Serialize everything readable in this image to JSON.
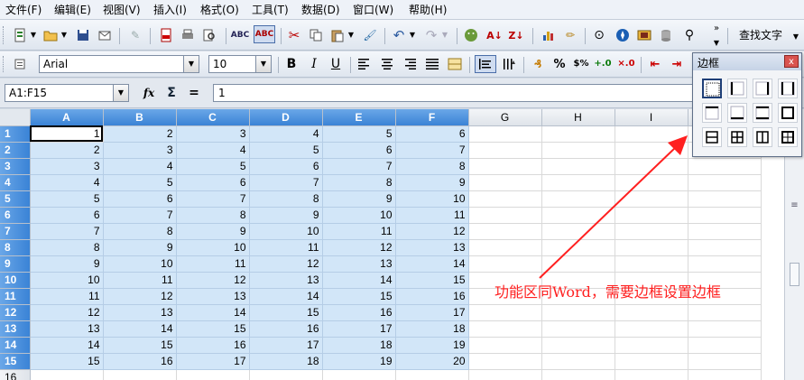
{
  "menu": [
    "文件(F)",
    "编辑(E)",
    "视图(V)",
    "插入(I)",
    "格式(O)",
    "工具(T)",
    "数据(D)",
    "窗口(W)",
    "帮助(H)"
  ],
  "toolbar": {
    "find_text_label": "查找文字"
  },
  "format": {
    "font_name": "Arial",
    "font_size": "10",
    "bold": "B",
    "italic": "I",
    "underline": "U",
    "percent": "%",
    "currency": "$%"
  },
  "formula_bar": {
    "name_box": "A1:F15",
    "fx": "fx",
    "sum": "Σ",
    "equals": "=",
    "value": "1"
  },
  "columns": [
    "A",
    "B",
    "C",
    "D",
    "E",
    "F",
    "G",
    "H",
    "I"
  ],
  "selected_columns": [
    "A",
    "B",
    "C",
    "D",
    "E",
    "F"
  ],
  "rows": [
    [
      "1",
      "2",
      "3",
      "4",
      "5",
      "6"
    ],
    [
      "2",
      "3",
      "4",
      "5",
      "6",
      "7"
    ],
    [
      "3",
      "4",
      "5",
      "6",
      "7",
      "8"
    ],
    [
      "4",
      "5",
      "6",
      "7",
      "8",
      "9"
    ],
    [
      "5",
      "6",
      "7",
      "8",
      "9",
      "10"
    ],
    [
      "6",
      "7",
      "8",
      "9",
      "10",
      "11"
    ],
    [
      "7",
      "8",
      "9",
      "10",
      "11",
      "12"
    ],
    [
      "8",
      "9",
      "10",
      "11",
      "12",
      "13"
    ],
    [
      "9",
      "10",
      "11",
      "12",
      "13",
      "14"
    ],
    [
      "10",
      "11",
      "12",
      "13",
      "14",
      "15"
    ],
    [
      "11",
      "12",
      "13",
      "14",
      "15",
      "16"
    ],
    [
      "12",
      "13",
      "14",
      "15",
      "16",
      "17"
    ],
    [
      "13",
      "14",
      "15",
      "16",
      "17",
      "18"
    ],
    [
      "14",
      "15",
      "16",
      "17",
      "18",
      "19"
    ],
    [
      "15",
      "16",
      "17",
      "18",
      "19",
      "20"
    ]
  ],
  "row_numbers": [
    "1",
    "2",
    "3",
    "4",
    "5",
    "6",
    "7",
    "8",
    "9",
    "10",
    "11",
    "12",
    "13",
    "14",
    "15",
    "16"
  ],
  "border_popup": {
    "title": "边框",
    "close": "x"
  },
  "annotation": "功能区同Word，需要边框设置边框",
  "colors": {
    "selection": "#d2e6f8",
    "header_selected": "#3a83d6",
    "annotation": "#ff2020"
  }
}
